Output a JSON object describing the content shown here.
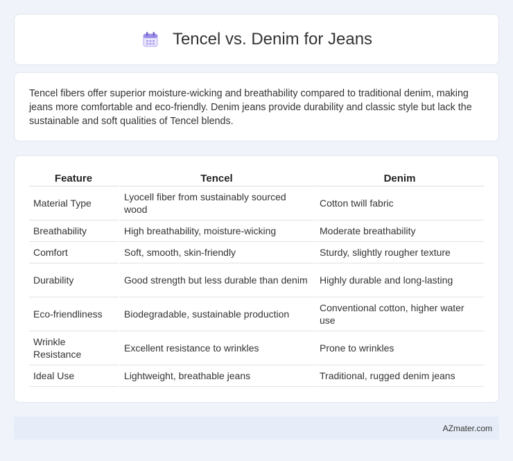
{
  "header": {
    "title": "Tencel vs. Denim for Jeans",
    "icon": "calendar-icon"
  },
  "intro": {
    "text": "Tencel fibers offer superior moisture-wicking and breathability compared to traditional denim, making jeans more comfortable and eco-friendly. Denim jeans provide durability and classic style but lack the sustainable and soft qualities of Tencel blends."
  },
  "table": {
    "headers": [
      "Feature",
      "Tencel",
      "Denim"
    ],
    "rows": [
      [
        "Material Type",
        "Lyocell fiber from sustainably sourced wood",
        "Cotton twill fabric"
      ],
      [
        "Breathability",
        "High breathability, moisture-wicking",
        "Moderate breathability"
      ],
      [
        "Comfort",
        "Soft, smooth, skin-friendly",
        "Sturdy, slightly rougher texture"
      ],
      [
        "Durability",
        "Good strength but less durable than denim",
        "Highly durable and long-lasting"
      ],
      [
        "Eco-friendliness",
        "Biodegradable, sustainable production",
        "Conventional cotton, higher water use"
      ],
      [
        "Wrinkle Resistance",
        "Excellent resistance to wrinkles",
        "Prone to wrinkles"
      ],
      [
        "Ideal Use",
        "Lightweight, breathable jeans",
        "Traditional, rugged denim jeans"
      ]
    ]
  },
  "footer": {
    "text": "AZmater.com"
  }
}
